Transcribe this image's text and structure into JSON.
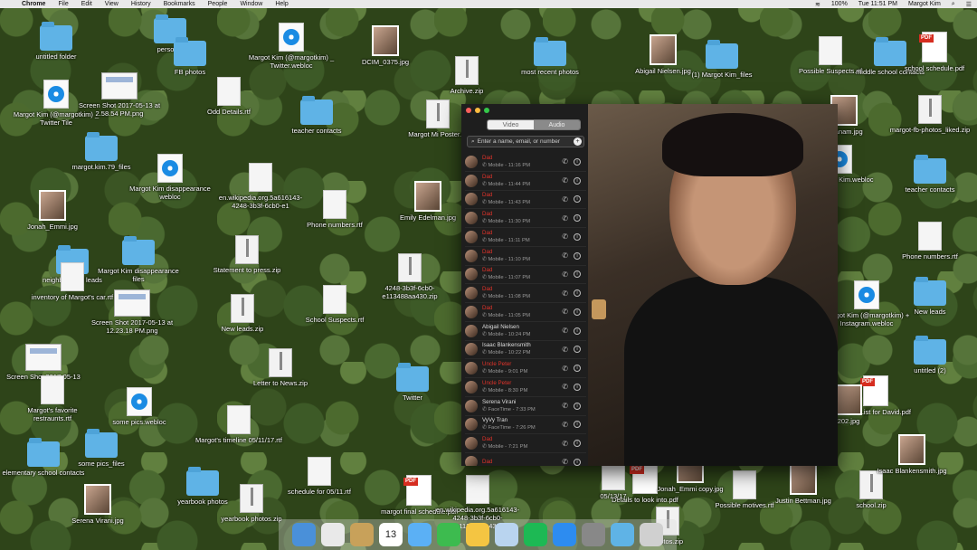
{
  "menubar": {
    "app": "Chrome",
    "items": [
      "File",
      "Edit",
      "View",
      "History",
      "Bookmarks",
      "People",
      "Window",
      "Help"
    ],
    "status": [
      "100%",
      "Tue 11:51 PM",
      "Margot Kim"
    ]
  },
  "desktop": {
    "icons": [
      {
        "label": "untitled folder",
        "type": "folder"
      },
      {
        "label": "personal",
        "type": "folder"
      },
      {
        "label": "FB photos",
        "type": "folder"
      },
      {
        "label": "Margot Kim (@margotkim) _ Twitter.webloc",
        "type": "webloc"
      },
      {
        "label": "DCIM_0375.jpg",
        "type": "img"
      },
      {
        "label": "Archive.zip",
        "type": "zip"
      },
      {
        "label": "most recent photos",
        "type": "folder"
      },
      {
        "label": "Abigail Nielsen.jpg",
        "type": "img"
      },
      {
        "label": "(1) Margot Kim_files",
        "type": "folder"
      },
      {
        "label": "Possible Suspects.rtf",
        "type": "doc"
      },
      {
        "label": "middle school contacts",
        "type": "folder"
      },
      {
        "label": "school schedule.pdf",
        "type": "pdf"
      },
      {
        "label": "Margot Kim (@margotkim) _ Twitter Tile",
        "type": "webloc"
      },
      {
        "label": "Screen Shot 2017-05-13 at 2.58.54 PM.png",
        "type": "shot"
      },
      {
        "label": "Odd Details.rtf",
        "type": "doc"
      },
      {
        "label": "teacher contacts",
        "type": "folder"
      },
      {
        "label": "Margot Mi Poster.rtf",
        "type": "zip"
      },
      {
        "label": "nthanam.jpg",
        "type": "img"
      },
      {
        "label": "margot-fb-photos_liked.zip",
        "type": "zip"
      },
      {
        "label": "margot.kim.79_files",
        "type": "folder"
      },
      {
        "label": "Margot Kim disappearance webloc",
        "type": "webloc"
      },
      {
        "label": "en.wikipedia.org.5a616143-4248-3b3f-6cb0-e1",
        "type": "doc"
      },
      {
        "label": "(1) Margot Kim.webloc",
        "type": "webloc"
      },
      {
        "label": "teacher contacts",
        "type": "folder"
      },
      {
        "label": "Jonah_Emmi.jpg",
        "type": "img"
      },
      {
        "label": "Phone numbers.rtf",
        "type": "doc"
      },
      {
        "label": "Emily Edelman.jpg",
        "type": "img"
      },
      {
        "label": "Phone numbers.rtf",
        "type": "doc"
      },
      {
        "label": "neighborhood leads",
        "type": "folder"
      },
      {
        "label": "Margot Kim disappearance files",
        "type": "folder"
      },
      {
        "label": "Statement to press.zip",
        "type": "zip"
      },
      {
        "label": "inventory of Margot's car.rtf",
        "type": "doc"
      },
      {
        "label": "4248-3b3f-6cb0-e113488aa430.zip",
        "type": "zip"
      },
      {
        "label": "Margot Kim (@margotkim) + Instagram.webloc",
        "type": "webloc"
      },
      {
        "label": "New leads",
        "type": "folder"
      },
      {
        "label": "Screen Shot 2017-05-13 at 12.23.18 PM.png",
        "type": "shot"
      },
      {
        "label": "School Suspects.rtf",
        "type": "doc"
      },
      {
        "label": "New leads.zip",
        "type": "zip"
      },
      {
        "label": "untitled (2)",
        "type": "folder"
      },
      {
        "label": "Screen Shot 2017-05-13",
        "type": "shot"
      },
      {
        "label": "Letter to News.zip",
        "type": "zip"
      },
      {
        "label": "Twitter",
        "type": "folder"
      },
      {
        "label": "Margot's favorite restraunts.rtf",
        "type": "doc"
      },
      {
        "label": "To Do List for David.pdf",
        "type": "pdf"
      },
      {
        "label": "some pics.webloc",
        "type": "webloc"
      },
      {
        "label": "Margot's timeline 05/11/17.rtf",
        "type": "doc"
      },
      {
        "label": "202.jpg",
        "type": "img"
      },
      {
        "label": "elementary school contacts",
        "type": "folder"
      },
      {
        "label": "some pics_files",
        "type": "folder"
      },
      {
        "label": "schedule for 05/11.rtf",
        "type": "doc"
      },
      {
        "label": "margot final schedule.pdf",
        "type": "pdf"
      },
      {
        "label": "en.wikipedia.org.5a616143-4248-3b3f-6cb0-e113488aa430",
        "type": "doc"
      },
      {
        "label": "Details to look into.pdf",
        "type": "pdf"
      },
      {
        "label": "Jonah_Emmi copy.jpg",
        "type": "img"
      },
      {
        "label": "Possible motives.rtf",
        "type": "doc"
      },
      {
        "label": "Justin Bettman.jpg",
        "type": "img"
      },
      {
        "label": "school.zip",
        "type": "zip"
      },
      {
        "label": "Isaac Blankensmith.jpg",
        "type": "img"
      },
      {
        "label": "yearbook photos",
        "type": "folder"
      },
      {
        "label": "yearbook photos.zip",
        "type": "zip"
      },
      {
        "label": "Serena Virani.jpg",
        "type": "img"
      },
      {
        "label": "photos.zip",
        "type": "zip"
      },
      {
        "label": "05/13/17",
        "type": "doc"
      }
    ]
  },
  "facetime": {
    "tabs": {
      "video": "Video",
      "audio": "Audio"
    },
    "search_placeholder": "Enter a name, email, or number",
    "calls": [
      {
        "name": "Dad",
        "sub": "Mobile - 11:16 PM",
        "missed": true
      },
      {
        "name": "Dad",
        "sub": "Mobile - 11:44 PM",
        "missed": true
      },
      {
        "name": "Dad",
        "sub": "Mobile - 11:43 PM",
        "missed": true
      },
      {
        "name": "Dad",
        "sub": "Mobile - 11:30 PM",
        "missed": true
      },
      {
        "name": "Dad",
        "sub": "Mobile - 11:11 PM",
        "missed": true
      },
      {
        "name": "Dad",
        "sub": "Mobile - 11:10 PM",
        "missed": true
      },
      {
        "name": "Dad",
        "sub": "Mobile - 11:07 PM",
        "missed": true
      },
      {
        "name": "Dad",
        "sub": "Mobile - 11:08 PM",
        "missed": true
      },
      {
        "name": "Dad",
        "sub": "Mobile - 11:05 PM",
        "missed": true
      },
      {
        "name": "Abigail Nielsen",
        "sub": "Mobile - 10:24 PM",
        "missed": false
      },
      {
        "name": "Isaac Blankensmith",
        "sub": "Mobile - 10:22 PM",
        "missed": false
      },
      {
        "name": "Uncle Peter",
        "sub": "Mobile - 9:01 PM",
        "missed": true
      },
      {
        "name": "Uncle Peter",
        "sub": "Mobile - 8:30 PM",
        "missed": true
      },
      {
        "name": "Serena Virani",
        "sub": "FaceTime - 7:33 PM",
        "missed": false
      },
      {
        "name": "VyVy Tran",
        "sub": "FaceTime - 7:26 PM",
        "missed": false
      },
      {
        "name": "Dad",
        "sub": "Mobile - 7:21 PM",
        "missed": true
      },
      {
        "name": "Dad",
        "sub": "",
        "missed": true
      }
    ]
  },
  "colors": {
    "missed": "#e1332a",
    "close": "#fc605c",
    "minimize": "#fdbc40",
    "zoom": "#34c84a"
  },
  "dock": {
    "apps": [
      "finder-icon",
      "chrome-icon",
      "notes-icon",
      "calendar-icon",
      "messages-icon",
      "facetime-icon",
      "photos-icon",
      "preview-icon",
      "spotify-icon",
      "appstore-icon",
      "settings-icon",
      "downloads-folder-icon",
      "trash-icon"
    ],
    "calendar_day": "13"
  }
}
